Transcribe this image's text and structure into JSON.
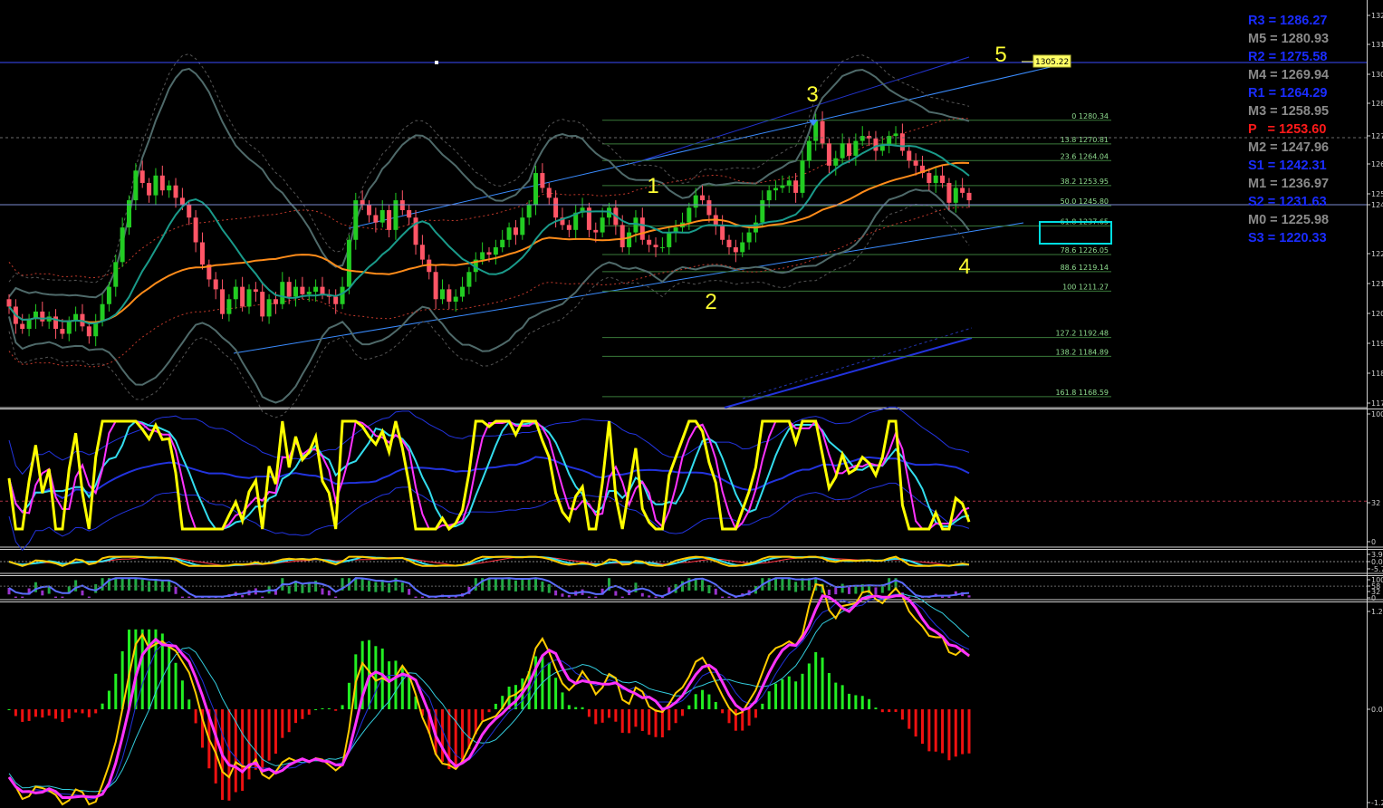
{
  "pivot_levels": [
    {
      "label": "R3 = 1286.27",
      "color": "#1a2cff"
    },
    {
      "label": "M5 = 1280.93",
      "color": "#8a8a8a"
    },
    {
      "label": "R2 = 1275.58",
      "color": "#1a2cff"
    },
    {
      "label": "M4 = 1269.94",
      "color": "#8a8a8a"
    },
    {
      "label": "R1 = 1264.29",
      "color": "#1a2cff"
    },
    {
      "label": "M3 = 1258.95",
      "color": "#8a8a8a"
    },
    {
      "label": "P   = 1253.60",
      "color": "#ff1a1a"
    },
    {
      "label": "M2 = 1247.96",
      "color": "#8a8a8a"
    },
    {
      "label": "S1 = 1242.31",
      "color": "#1a2cff"
    },
    {
      "label": "M1 = 1236.97",
      "color": "#8a8a8a"
    },
    {
      "label": "S2 = 1231.63",
      "color": "#1a2cff"
    },
    {
      "label": "M0 = 1225.98",
      "color": "#8a8a8a"
    },
    {
      "label": "S3 = 1220.33",
      "color": "#1a2cff"
    }
  ],
  "fib_levels": [
    {
      "label": "0 1280.34",
      "price": 1280.34
    },
    {
      "label": "13.8 1270.81",
      "price": 1270.81
    },
    {
      "label": "23.6 1264.04",
      "price": 1264.04
    },
    {
      "label": "38.2 1253.95",
      "price": 1253.95
    },
    {
      "label": "50.0 1245.80",
      "price": 1245.8
    },
    {
      "label": "61.8 1237.65",
      "price": 1237.65
    },
    {
      "label": "78.6 1226.05",
      "price": 1226.05
    },
    {
      "label": "88.6 1219.14",
      "price": 1219.14
    },
    {
      "label": "100 1211.27",
      "price": 1211.27
    },
    {
      "label": "127.2 1192.48",
      "price": 1192.48
    },
    {
      "label": "138.2 1184.89",
      "price": 1184.89
    },
    {
      "label": "161.8 1168.59",
      "price": 1168.59
    }
  ],
  "target_label": "1305.22",
  "wave_labels": [
    "1",
    "2",
    "3",
    "4",
    "5"
  ],
  "axes": {
    "main_ticks": [
      "132",
      "131",
      "130",
      "128",
      "127",
      "126",
      "125",
      "124",
      "122",
      "121",
      "120",
      "119",
      "118",
      "117"
    ],
    "osc1_ticks": [
      "100",
      "32",
      "0"
    ],
    "osc2_ticks": [
      "3.90",
      "0.0",
      "-5.7"
    ],
    "osc3_ticks": [
      "100",
      "58",
      "32",
      "0"
    ],
    "macd_ticks": [
      "1.28",
      "0.00",
      "-1.2"
    ]
  },
  "colors": {
    "background": "#000000",
    "bull": "#22cc22",
    "bear": "#ff5566",
    "ma_orange": "#ff8c1a",
    "ma_teal": "#1a9a8a",
    "bands_gray": "#4f6a6a",
    "trend_blue": "#3a8cff",
    "wave_yellow": "#ffff33",
    "rsi_yellow": "#ffff00",
    "signal_magenta": "#ff33ff",
    "signal_cyan": "#33ddee",
    "hist_green": "#22ee22",
    "hist_red": "#ee1111",
    "fib_green": "#3a7a3a",
    "fib_text": "#8fdc8f"
  },
  "chart_data": {
    "type": "candlestick",
    "timeframe": "",
    "closes": [
      1205,
      1198,
      1196,
      1200,
      1203,
      1199,
      1201,
      1196,
      1194,
      1199,
      1202,
      1197,
      1193,
      1199,
      1206,
      1213,
      1223,
      1237,
      1248,
      1260,
      1255,
      1250,
      1258,
      1252,
      1254,
      1249,
      1246,
      1241,
      1231,
      1222,
      1216,
      1212,
      1202,
      1208,
      1213,
      1205,
      1212,
      1211,
      1201,
      1208,
      1206,
      1215,
      1209,
      1213,
      1210,
      1211,
      1213,
      1210,
      1209,
      1206,
      1213,
      1232,
      1248,
      1246,
      1242,
      1239,
      1244,
      1236,
      1248,
      1244,
      1241,
      1230,
      1224,
      1219,
      1208,
      1212,
      1207,
      1209,
      1213,
      1219,
      1224,
      1227,
      1226,
      1229,
      1232,
      1237,
      1234,
      1241,
      1246,
      1259,
      1253,
      1249,
      1241,
      1238,
      1236,
      1243,
      1245,
      1236,
      1235,
      1241,
      1245,
      1238,
      1229,
      1235,
      1241,
      1232,
      1230,
      1229,
      1229,
      1235,
      1237,
      1239,
      1245,
      1250,
      1248,
      1242,
      1238,
      1232,
      1229,
      1227,
      1231,
      1235,
      1239,
      1248,
      1252,
      1253,
      1254,
      1256,
      1251,
      1264,
      1272,
      1280,
      1271,
      1262,
      1265,
      1271,
      1266,
      1272,
      1274,
      1273,
      1268,
      1270,
      1274,
      1275,
      1268,
      1264,
      1262,
      1259,
      1255,
      1258,
      1255,
      1247,
      1253,
      1251,
      1248
    ],
    "price_range": [
      1165,
      1325
    ],
    "oscillator_rsi": {
      "range": [
        0,
        100
      ],
      "level": 32
    },
    "macd": {
      "range": [
        -1.3,
        1.28
      ]
    }
  }
}
